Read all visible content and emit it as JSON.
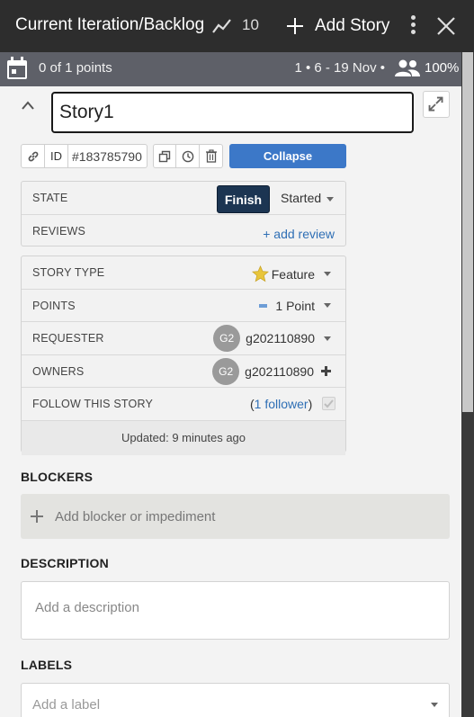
{
  "header": {
    "title": "Current Iteration/Backlog",
    "velocity_icon": "trend-line-icon",
    "velocity": "10",
    "add_story_label": "Add Story",
    "more_icon": "kebab-menu-icon",
    "close_icon": "close-icon"
  },
  "iteration": {
    "calendar_icon": "calendar-icon",
    "points": "0 of 1 points",
    "range": "1 • 6 - 19 Nov •",
    "people_icon": "people-icon",
    "percent": "100%"
  },
  "story": {
    "name": "Story1",
    "id_label": "ID",
    "id_value": "#183785790",
    "collapse_label": "Collapse",
    "state": {
      "label": "STATE",
      "finish_label": "Finish",
      "value": "Started"
    },
    "reviews": {
      "label": "REVIEWS",
      "add_label": "+ add review"
    },
    "details": {
      "story_type_label": "STORY TYPE",
      "story_type": "Feature",
      "points_label": "POINTS",
      "points": "1 Point",
      "requester_label": "REQUESTER",
      "requester_initials": "G2",
      "requester": "g202110890",
      "owners_label": "OWNERS",
      "owner_initials": "G2",
      "owner": "g202110890",
      "follow_label": "FOLLOW THIS STORY",
      "followers_open": "(",
      "followers_link": "1 follower",
      "followers_close": ")",
      "updated": "Updated: 9 minutes ago"
    },
    "blockers": {
      "title": "BLOCKERS",
      "placeholder": "Add blocker or impediment"
    },
    "description": {
      "title": "DESCRIPTION",
      "placeholder": "Add a description"
    },
    "labels": {
      "title": "LABELS",
      "placeholder": "Add a label"
    }
  },
  "colors": {
    "header_bg": "#2d2d2d",
    "iteration_bg": "#5e6068",
    "collapse_blue": "#3c78c8",
    "finish_navy": "#1c3552",
    "link_blue": "#2f6fb5",
    "feature_star": "#e8c53a"
  }
}
